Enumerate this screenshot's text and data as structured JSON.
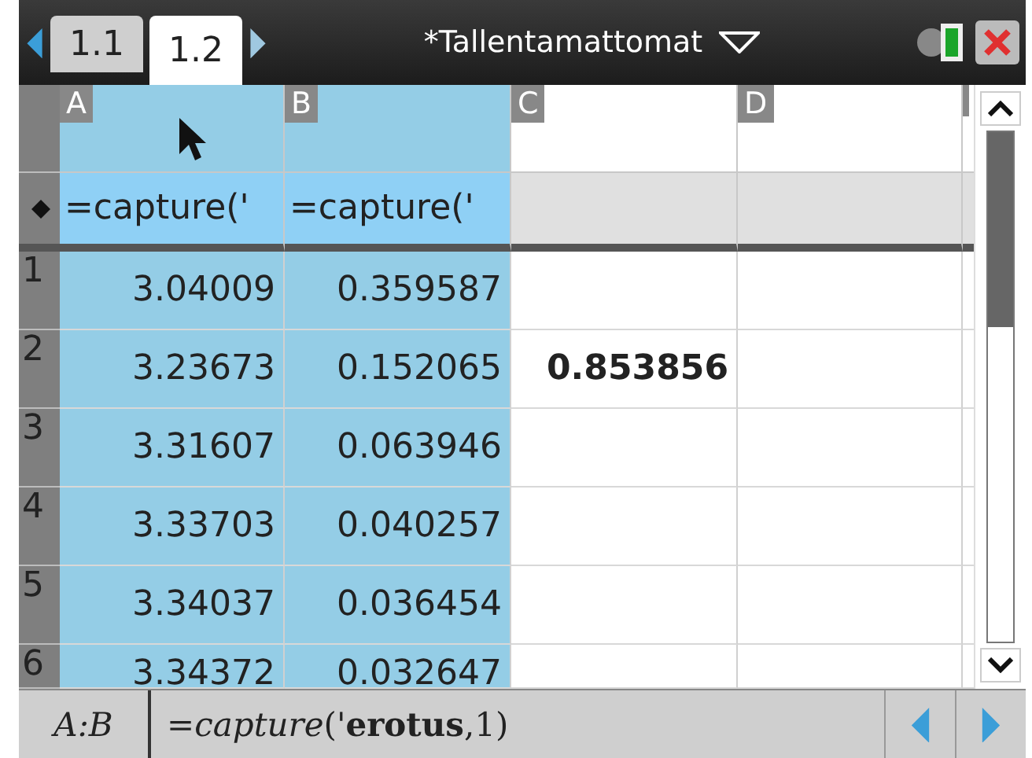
{
  "window": {
    "tabs": [
      {
        "label": "1.1",
        "selected": false
      },
      {
        "label": "1.2",
        "selected": true
      }
    ],
    "title": "*Tallentamattomat"
  },
  "sheet": {
    "columns": [
      {
        "letter": "A",
        "selected": true,
        "formula": "=capture('"
      },
      {
        "letter": "B",
        "selected": true,
        "formula": "=capture('"
      },
      {
        "letter": "C",
        "selected": false
      },
      {
        "letter": "D",
        "selected": false
      }
    ],
    "rows": [
      {
        "number": "1",
        "values": [
          {
            "text": "3.04009",
            "bold": false
          },
          {
            "text": "0.359587",
            "bold": false
          }
        ]
      },
      {
        "number": "2",
        "values": [
          {
            "text": "3.23673",
            "bold": false
          },
          {
            "text": "0.152065",
            "bold": false
          },
          {
            "text": "0.853856",
            "bold": true
          }
        ]
      },
      {
        "number": "3",
        "values": [
          {
            "text": "3.31607",
            "bold": false
          },
          {
            "text": "0.063946",
            "bold": false
          }
        ]
      },
      {
        "number": "4",
        "values": [
          {
            "text": "3.33703",
            "bold": false
          },
          {
            "text": "0.040257",
            "bold": false
          }
        ]
      },
      {
        "number": "5",
        "values": [
          {
            "text": "3.34037",
            "bold": false
          },
          {
            "text": "0.036454",
            "bold": false
          }
        ]
      },
      {
        "number": "6",
        "values": [
          {
            "text": "3.34372",
            "bold": false
          },
          {
            "text": "0.032647",
            "bold": false
          }
        ]
      }
    ]
  },
  "entry_line": {
    "cell_range": "A:B",
    "formula": "=*capture*('**erotus**,1)"
  }
}
